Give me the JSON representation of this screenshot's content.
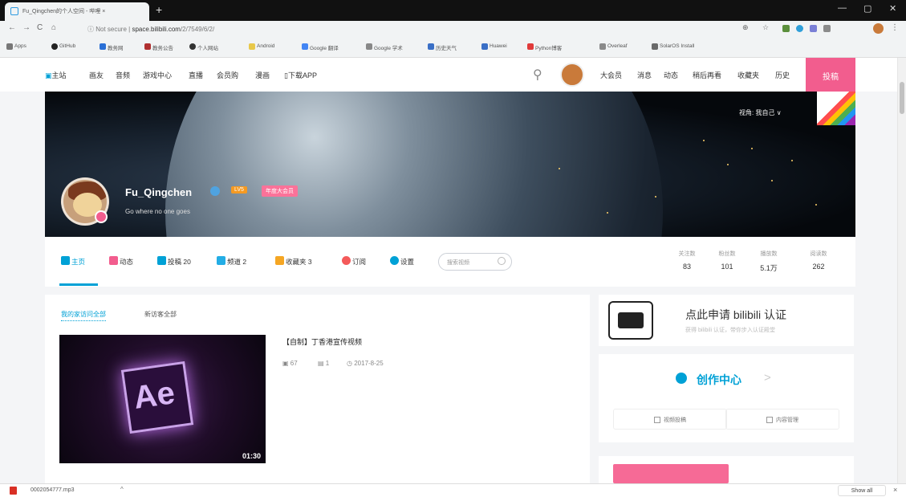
{
  "browser": {
    "tab_title": "Fu_Qingchen的个人空间 - 哔哩 ×",
    "tab_close": "×",
    "new_tab": "+",
    "window_minimize": "—",
    "window_maximize": "▢",
    "window_close": "✕",
    "url_security": "Not secure",
    "url_host": "space.bilibili.com",
    "url_path": "/2/7549/6/2/",
    "bookmarks": [
      "Apps",
      "GitHub",
      "教务网",
      "教务公告",
      "个人网站",
      "Android",
      "Google 翻译",
      "Google 学术",
      "历史天气",
      "Huawei",
      "Python博客",
      "Overleaf",
      "SolarOS Install"
    ]
  },
  "site_header": {
    "nav_left": [
      "主站",
      "画友",
      "音频",
      "游戏中心",
      "直播",
      "会员购",
      "漫画",
      "下载APP"
    ],
    "nav_right": [
      "大会员",
      "消息",
      "动态",
      "稍后再看",
      "收藏夹",
      "历史"
    ],
    "upload_label": "投稿"
  },
  "profile": {
    "username": "Fu_Qingchen",
    "level": "LV5",
    "vip_tag": "年度大会员",
    "signature": "Go where no one goes",
    "viewer_label": "视角:",
    "viewer_value": "我自己 ∨"
  },
  "subnav": {
    "items": [
      {
        "label": "主页",
        "color": "#00a1d6"
      },
      {
        "label": "动态",
        "color": "#f25d8e"
      },
      {
        "label": "投稿 20",
        "color": "#00a1d6"
      },
      {
        "label": "频道 2",
        "color": "#23ade5"
      },
      {
        "label": "收藏夹 3",
        "color": "#f5a623"
      },
      {
        "label": "订阅",
        "color": "#f45a5a"
      },
      {
        "label": "设置",
        "color": "#00a1d6"
      }
    ],
    "search_placeholder": "搜索视频"
  },
  "stats": [
    {
      "label": "关注数",
      "value": "83"
    },
    {
      "label": "粉丝数",
      "value": "101"
    },
    {
      "label": "播放数",
      "value": "5.1万"
    },
    {
      "label": "阅读数",
      "value": "262"
    }
  ],
  "main": {
    "tabs": [
      "我的家访问全部",
      "新访客全部"
    ],
    "video": {
      "title": "【自制】丁香港宣传视频",
      "duration": "01:30",
      "plays": "67",
      "comments": "1",
      "date": "2017-8-25",
      "thumb_text": "Ae"
    }
  },
  "sidebar": {
    "certify_title": "点此申请 bilibili 认证",
    "certify_sub": "获得 bilibili 认证，带你步入认证殿堂",
    "creator_title": "创作中心",
    "creator_arrow": ">",
    "creator_buttons": [
      "视频投稿",
      "内容管理"
    ]
  },
  "downloads": {
    "file": "0002054777.mp3",
    "chevron": "^",
    "show_all": "Show all",
    "close": "×"
  }
}
